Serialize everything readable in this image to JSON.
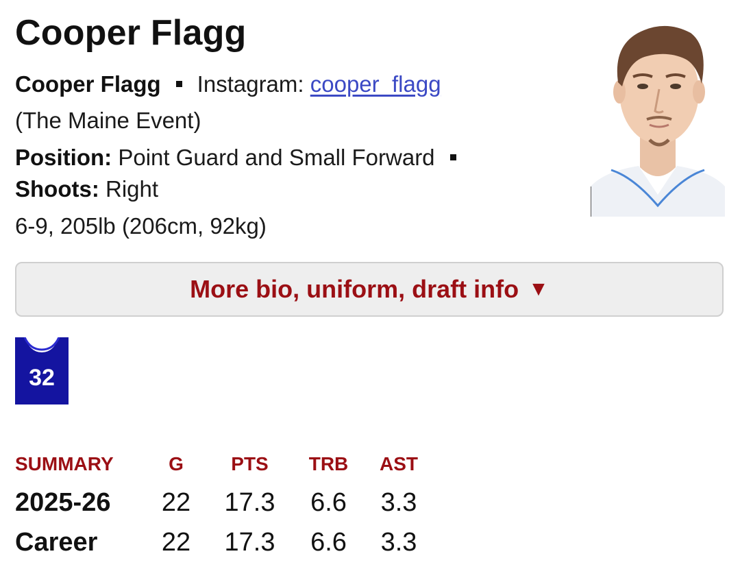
{
  "player": {
    "name": "Cooper Flagg",
    "full_name": "Cooper Flagg",
    "instagram_label": "Instagram:",
    "instagram_handle": "cooper_flagg",
    "nickname": "(The Maine Event)",
    "position_label": "Position:",
    "position_value": "Point Guard and Small Forward",
    "shoots_label": "Shoots:",
    "shoots_value": "Right",
    "measurements": "6-9, 205lb (206cm, 92kg)"
  },
  "bio_button": {
    "label": "More bio, uniform, draft info",
    "icon": "caret-down-icon",
    "glyph": "▼"
  },
  "uniform": {
    "number": "32",
    "jersey_color": "#1414a0"
  },
  "summary": {
    "headers": [
      "SUMMARY",
      "G",
      "PTS",
      "TRB",
      "AST"
    ],
    "rows": [
      [
        "2025-26",
        "22",
        "17.3",
        "6.6",
        "3.3"
      ],
      [
        "Career",
        "22",
        "17.3",
        "6.6",
        "3.3"
      ]
    ]
  },
  "colors": {
    "accent": "#9b0f14",
    "link": "#3b49c4",
    "button_bg": "#eeeeee"
  }
}
